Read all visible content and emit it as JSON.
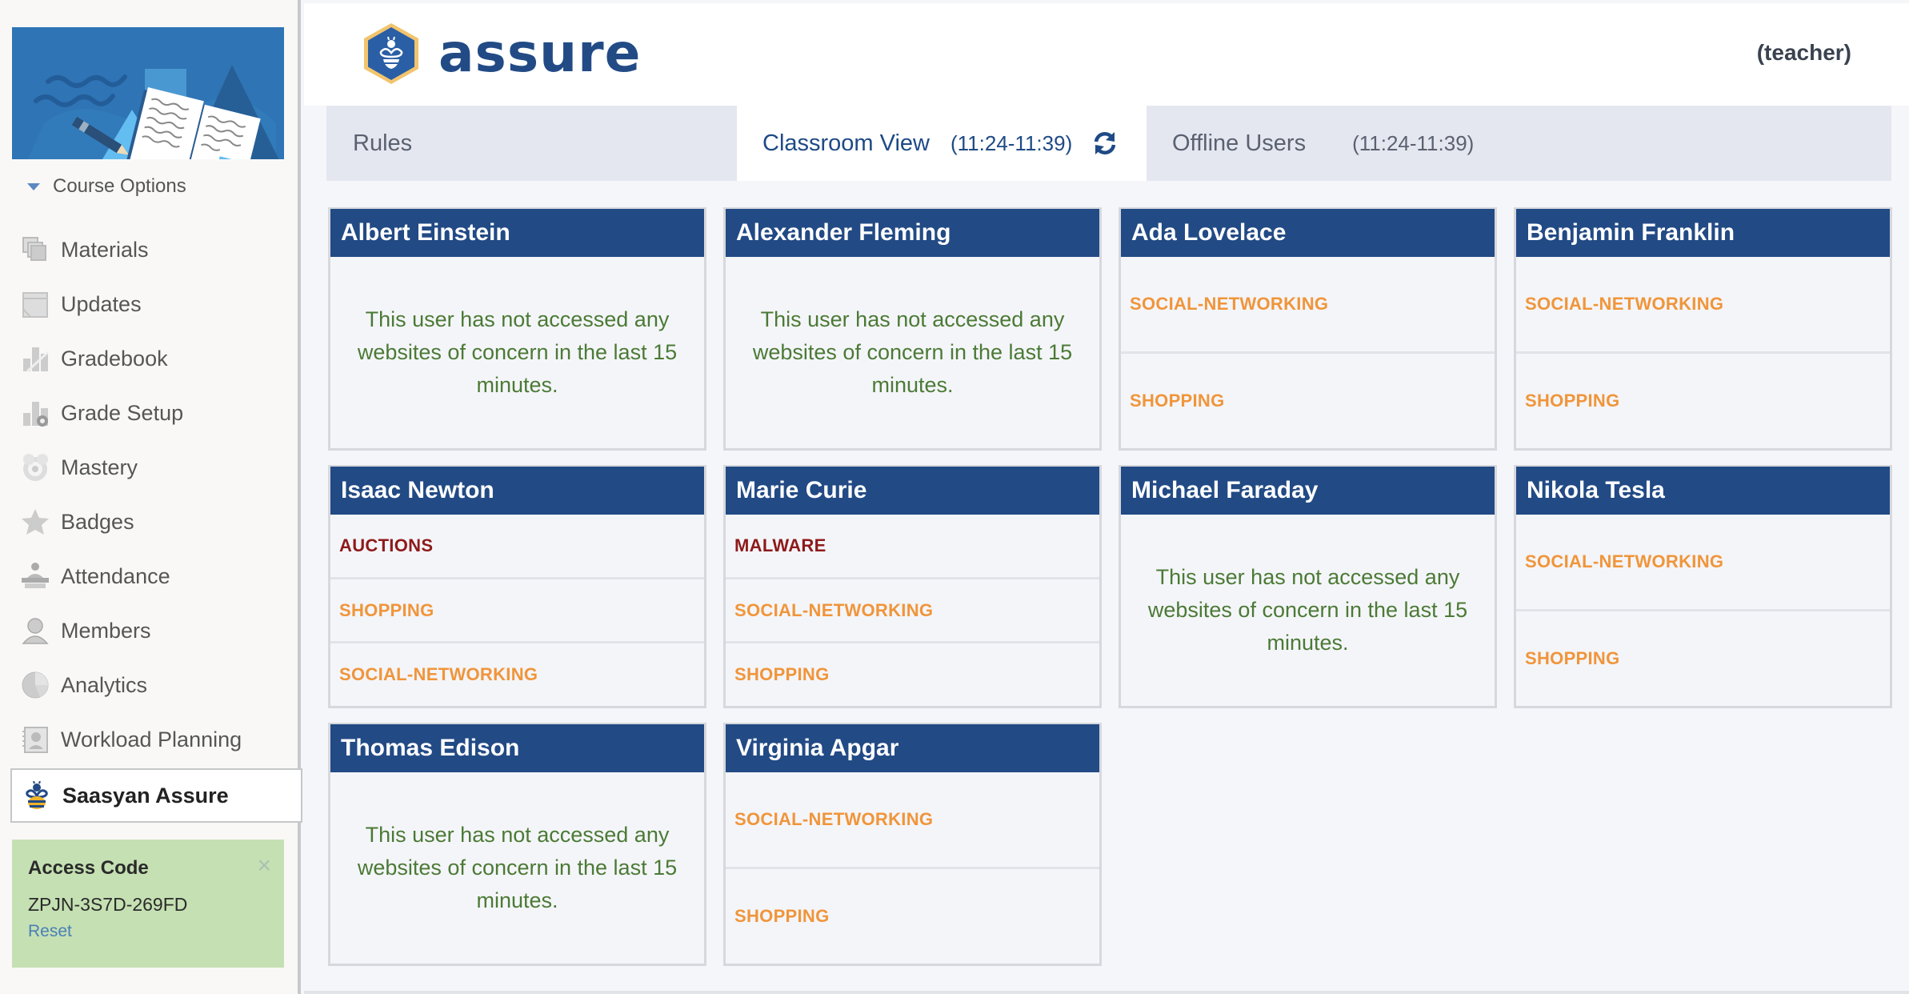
{
  "sidebar": {
    "course_options_label": "Course Options",
    "items": [
      {
        "label": "Materials",
        "icon": "materials-icon"
      },
      {
        "label": "Updates",
        "icon": "updates-icon"
      },
      {
        "label": "Gradebook",
        "icon": "gradebook-icon"
      },
      {
        "label": "Grade Setup",
        "icon": "grade-setup-icon"
      },
      {
        "label": "Mastery",
        "icon": "mastery-icon"
      },
      {
        "label": "Badges",
        "icon": "badge-star-icon"
      },
      {
        "label": "Attendance",
        "icon": "attendance-icon"
      },
      {
        "label": "Members",
        "icon": "members-icon"
      },
      {
        "label": "Analytics",
        "icon": "analytics-pie-icon"
      },
      {
        "label": "Workload Planning",
        "icon": "workload-planning-icon"
      },
      {
        "label": "Saasyan Assure",
        "icon": "bee-icon",
        "active": true
      }
    ],
    "access_code": {
      "title": "Access Code",
      "code": "ZPJN-3S7D-269FD",
      "reset_label": "Reset",
      "close_symbol": "×"
    }
  },
  "header": {
    "logo_text": "assure",
    "role": "(teacher)"
  },
  "tabs": {
    "rules": {
      "label": "Rules"
    },
    "classroom": {
      "label": "Classroom View",
      "time_range": "(11:24-11:39)",
      "active": true
    },
    "offline": {
      "label": "Offline Users",
      "time_range": "(11:24-11:39)"
    }
  },
  "colors": {
    "brand_navy": "#224a85",
    "warning_orange": "#f0953a",
    "danger_red": "#8e1a1a",
    "ok_green": "#4b7a35",
    "access_box_green": "#c5e0b3"
  },
  "empty_message": "This user has not accessed any websites of concern in the last 15 minutes.",
  "students": [
    {
      "name": "Albert Einstein",
      "categories": []
    },
    {
      "name": "Alexander Fleming",
      "categories": []
    },
    {
      "name": "Ada Lovelace",
      "categories": [
        {
          "label": "SOCIAL-NETWORKING",
          "severity": "warning"
        },
        {
          "label": "SHOPPING",
          "severity": "warning"
        }
      ]
    },
    {
      "name": "Benjamin Franklin",
      "categories": [
        {
          "label": "SOCIAL-NETWORKING",
          "severity": "warning"
        },
        {
          "label": "SHOPPING",
          "severity": "warning"
        }
      ]
    },
    {
      "name": "Isaac Newton",
      "categories": [
        {
          "label": "AUCTIONS",
          "severity": "danger"
        },
        {
          "label": "SHOPPING",
          "severity": "warning"
        },
        {
          "label": "SOCIAL-NETWORKING",
          "severity": "warning"
        }
      ]
    },
    {
      "name": "Marie Curie",
      "categories": [
        {
          "label": "MALWARE",
          "severity": "danger"
        },
        {
          "label": "SOCIAL-NETWORKING",
          "severity": "warning"
        },
        {
          "label": "SHOPPING",
          "severity": "warning"
        }
      ]
    },
    {
      "name": "Michael Faraday",
      "categories": []
    },
    {
      "name": "Nikola Tesla",
      "categories": [
        {
          "label": "SOCIAL-NETWORKING",
          "severity": "warning"
        },
        {
          "label": "SHOPPING",
          "severity": "warning"
        }
      ]
    },
    {
      "name": "Thomas Edison",
      "categories": []
    },
    {
      "name": "Virginia Apgar",
      "categories": [
        {
          "label": "SOCIAL-NETWORKING",
          "severity": "warning"
        },
        {
          "label": "SHOPPING",
          "severity": "warning"
        }
      ]
    }
  ]
}
